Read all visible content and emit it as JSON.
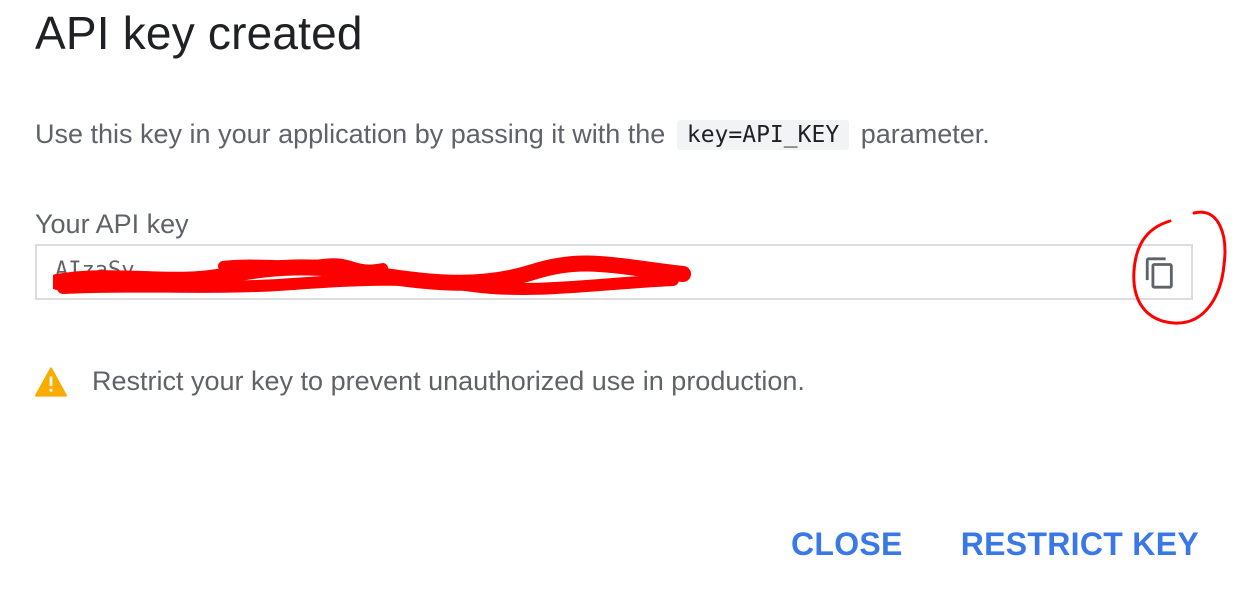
{
  "dialog": {
    "title": "API key created",
    "description_before": "Use this key in your application by passing it with the",
    "description_code": "key=API_KEY",
    "description_after": "parameter.",
    "field_label": "Your API key",
    "key_value": "AIzaSy",
    "copy_icon": "copy-icon",
    "warning_icon": "warning-icon",
    "warning_text": "Restrict your key to prevent unauthorized use in production.",
    "close_label": "CLOSE",
    "restrict_label": "RESTRICT KEY"
  },
  "colors": {
    "accent": "#3b78e7",
    "warning": "#f9ab00",
    "annotation": "#ff0000",
    "text_secondary": "#5f6368"
  }
}
